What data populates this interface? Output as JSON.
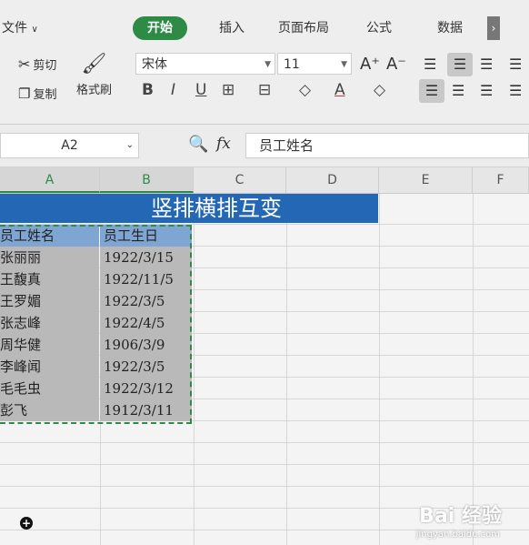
{
  "ribbon": {
    "tabs": [
      {
        "label": "文件",
        "active": false
      },
      {
        "label": "开始",
        "active": true
      },
      {
        "label": "插入",
        "active": false
      },
      {
        "label": "页面布局",
        "active": false
      },
      {
        "label": "公式",
        "active": false
      },
      {
        "label": "数据",
        "active": false
      }
    ],
    "more_glyph": "›",
    "clipboard": {
      "cut": "剪切",
      "copy": "复制",
      "format_painter": "格式刷"
    },
    "font_name": "宋体",
    "font_size": "11"
  },
  "formula_bar": {
    "cell_ref": "A2",
    "fx": "fx",
    "value": "员工姓名"
  },
  "columns": [
    "A",
    "B",
    "C",
    "D",
    "E",
    "F"
  ],
  "sheet": {
    "title": "竖排横排互变",
    "headers": [
      "员工姓名",
      "员工生日"
    ],
    "rows": [
      [
        "张丽丽",
        "1922/3/15"
      ],
      [
        "王馥真",
        "1922/11/5"
      ],
      [
        "王罗媚",
        "1922/3/5"
      ],
      [
        "张志峰",
        "1922/4/5"
      ],
      [
        "周华健",
        "1906/3/9"
      ],
      [
        "李峰闻",
        "1922/3/5"
      ],
      [
        "毛毛虫",
        "1922/3/12"
      ],
      [
        "彭飞",
        "1912/3/11"
      ]
    ]
  },
  "watermark": {
    "text": "Bai 经验",
    "sub": "jingyan.baidu.com"
  }
}
